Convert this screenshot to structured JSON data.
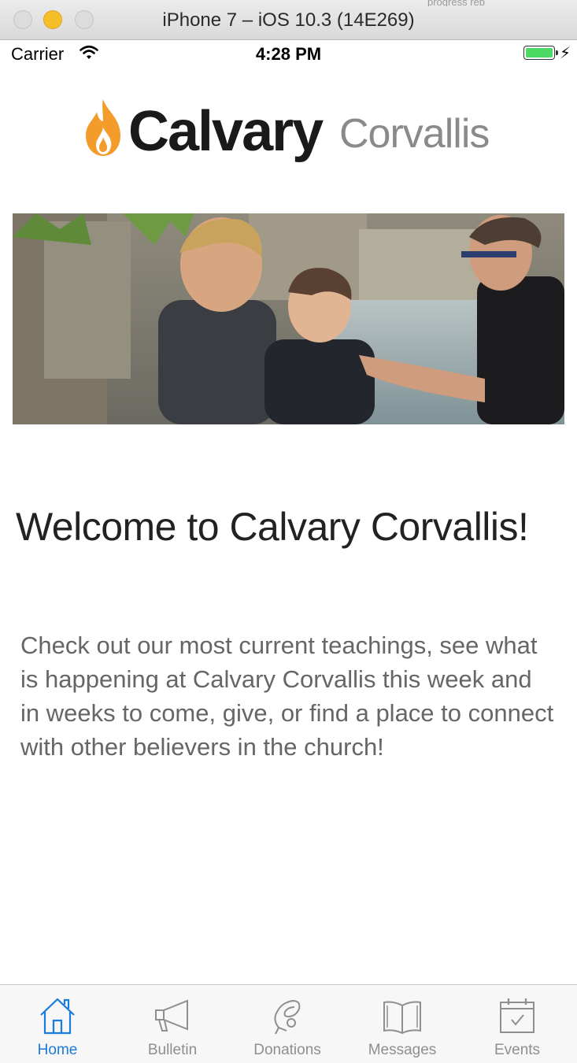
{
  "window": {
    "title": "iPhone 7 – iOS 10.3 (14E269)",
    "background_note": "progress reb"
  },
  "status_bar": {
    "carrier": "Carrier",
    "time": "4:28 PM",
    "battery_color": "#4cd964"
  },
  "logo": {
    "main": "Calvary",
    "sub": "Corvallis",
    "flame_color": "#f39c2b"
  },
  "hero": {
    "alt": "photo"
  },
  "content": {
    "welcome": "Welcome to Calvary Corvallis!",
    "intro": "Check out our most current teachings, see what is happening at Calvary Corvallis this week and in weeks to come, give, or find a place to connect with other believers in the church!"
  },
  "tabs": [
    {
      "label": "Home",
      "icon": "home-icon",
      "active": true
    },
    {
      "label": "Bulletin",
      "icon": "megaphone-icon",
      "active": false
    },
    {
      "label": "Donations",
      "icon": "donation-hand-icon",
      "active": false
    },
    {
      "label": "Messages",
      "icon": "book-icon",
      "active": false
    },
    {
      "label": "Events",
      "icon": "calendar-icon",
      "active": false
    }
  ],
  "colors": {
    "active_tab": "#1a7bdc",
    "inactive_tab": "#8e8e93"
  }
}
